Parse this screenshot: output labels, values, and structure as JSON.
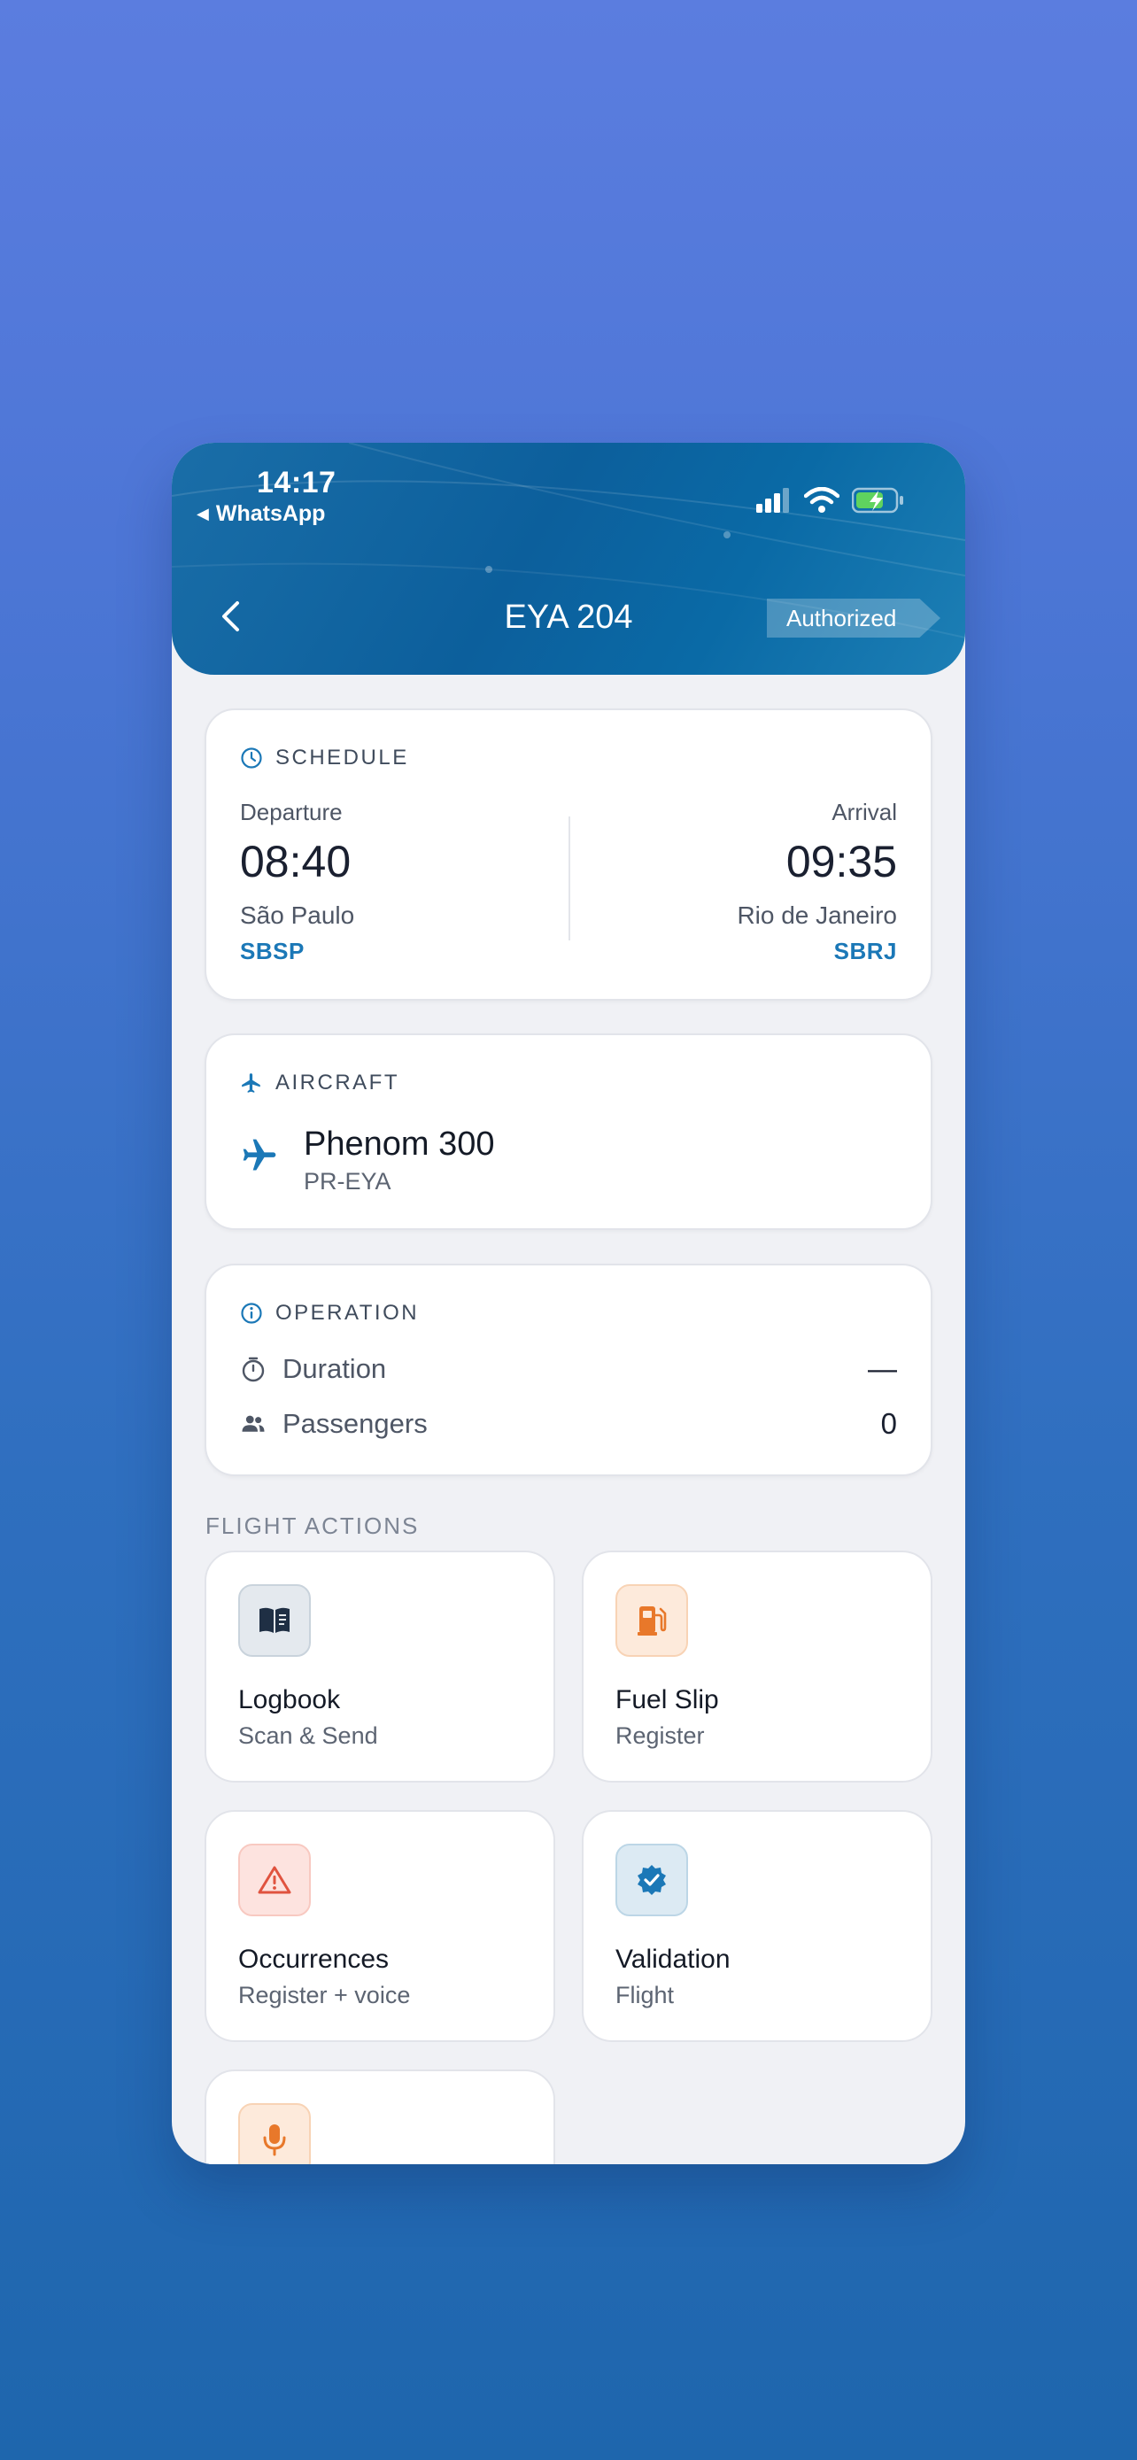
{
  "status_bar": {
    "time": "14:17",
    "back_app": "WhatsApp"
  },
  "header": {
    "title": "EYA 204",
    "badge": "Authorized"
  },
  "schedule": {
    "heading": "SCHEDULE",
    "departure": {
      "label": "Departure",
      "time": "08:40",
      "city": "São Paulo",
      "code": "SBSP"
    },
    "arrival": {
      "label": "Arrival",
      "time": "09:35",
      "city": "Rio de Janeiro",
      "code": "SBRJ"
    }
  },
  "aircraft": {
    "heading": "AIRCRAFT",
    "model": "Phenom 300",
    "registration": "PR-EYA"
  },
  "operation": {
    "heading": "OPERATION",
    "rows": [
      {
        "label": "Duration",
        "value": "—"
      },
      {
        "label": "Passengers",
        "value": "0"
      }
    ]
  },
  "flight_actions": {
    "heading": "FLIGHT ACTIONS",
    "tiles": [
      {
        "title": "Logbook",
        "subtitle": "Scan & Send",
        "icon": "book-icon"
      },
      {
        "title": "Fuel Slip",
        "subtitle": "Register",
        "icon": "fuel-pump-icon"
      },
      {
        "title": "Occurrences",
        "subtitle": "Register + voice",
        "icon": "warning-icon"
      },
      {
        "title": "Validation",
        "subtitle": "Flight",
        "icon": "verified-badge-icon"
      },
      {
        "title": "",
        "subtitle": "",
        "icon": "microphone-icon"
      }
    ]
  },
  "colors": {
    "accent": "#1b78b7",
    "header_bg": "#0c5f9c",
    "fuel_icon": "#e8782a",
    "warning_icon": "#e0533f",
    "validation_icon": "#1b78b7"
  }
}
